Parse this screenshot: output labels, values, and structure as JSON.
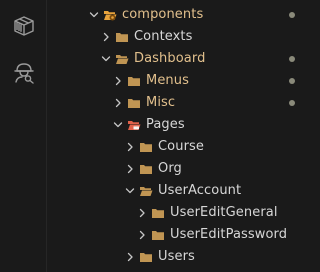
{
  "activity_bar": {
    "icons": [
      "package-icon",
      "user-search-icon"
    ]
  },
  "tree": {
    "items": [
      {
        "label": "components",
        "depth": 0,
        "expanded": true,
        "folder_style": "special-open",
        "modified": true
      },
      {
        "label": "Contexts",
        "depth": 1,
        "expanded": false,
        "folder_style": "closed",
        "modified": false
      },
      {
        "label": "Dashboard",
        "depth": 1,
        "expanded": true,
        "folder_style": "open",
        "modified": true
      },
      {
        "label": "Menus",
        "depth": 2,
        "expanded": false,
        "folder_style": "closed",
        "modified": true
      },
      {
        "label": "Misc",
        "depth": 2,
        "expanded": false,
        "folder_style": "closed",
        "modified": true
      },
      {
        "label": "Pages",
        "depth": 2,
        "expanded": true,
        "folder_style": "pages-open",
        "modified": false
      },
      {
        "label": "Course",
        "depth": 3,
        "expanded": false,
        "folder_style": "closed",
        "modified": false
      },
      {
        "label": "Org",
        "depth": 3,
        "expanded": false,
        "folder_style": "closed",
        "modified": false
      },
      {
        "label": "UserAccount",
        "depth": 3,
        "expanded": true,
        "folder_style": "open",
        "modified": false
      },
      {
        "label": "UserEditGeneral",
        "depth": 4,
        "expanded": false,
        "folder_style": "closed",
        "modified": false
      },
      {
        "label": "UserEditPassword",
        "depth": 4,
        "expanded": false,
        "folder_style": "closed",
        "modified": false
      },
      {
        "label": "Users",
        "depth": 3,
        "expanded": false,
        "folder_style": "closed",
        "modified": false
      }
    ]
  },
  "colors": {
    "background": "#1a1a1a",
    "text": "#d7d7d7",
    "modified_text": "#e2c08d",
    "folder": "#c09553",
    "folder_special": "#e8a33c",
    "pages_folder": "#e0614a",
    "dot": "#8a8a7a"
  }
}
